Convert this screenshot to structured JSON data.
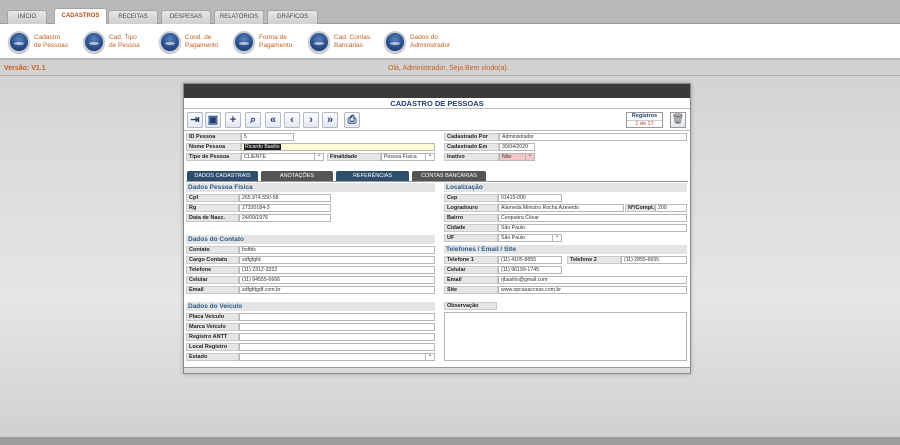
{
  "tabs": [
    "INÍCIO",
    "CADASTROS",
    "RECEITAS",
    "DESPESAS",
    "RELATÓRIOS",
    "GRÁFICOS"
  ],
  "active_tab": "CADASTROS",
  "submenu": [
    {
      "label": "Cadastro\nde Pessoas",
      "icon": "person-globe-icon"
    },
    {
      "label": "Cad. Tipo\nde Pessoa",
      "icon": "type-globe-icon"
    },
    {
      "label": "Cond. de\nPagamento",
      "icon": "payment-globe-icon"
    },
    {
      "label": "Forma de\nPagamento",
      "icon": "method-globe-icon"
    },
    {
      "label": "Cad. Contas\nBancárias",
      "icon": "bank-globe-icon"
    },
    {
      "label": "Dados do\nAdministrador",
      "icon": "admin-globe-icon"
    }
  ],
  "version": "Versão: V1.1",
  "welcome": "Olá, Administrador, Seja Bem vindo(a).",
  "form": {
    "title": "CADASTRO DE PESSOAS",
    "toolbar_icons": [
      "exit-icon",
      "save-icon",
      "add-icon",
      "search-icon",
      "first-icon",
      "previous-icon",
      "next-icon",
      "last-icon",
      "print-icon"
    ],
    "registros_label": "Registros",
    "registros_value": "1 de 17",
    "delete_icon": "trash-icon",
    "id_label": "ID Pessoa",
    "id_value": "5",
    "nome_label": "Nome Pessoa",
    "nome_value": "Ricardo Basilio",
    "tipo_label": "Tipo de Pessoa",
    "tipo_value": "CLIENTE",
    "finalidade_label": "Finalidade",
    "finalidade_value": "Pessoa Física",
    "cad_por_label": "Cadastrado Por",
    "cad_por_value": "Administrador",
    "cad_em_label": "Cadastrado Em",
    "cad_em_value": "30/04/2020",
    "inativo_label": "Inativo",
    "inativo_value": "Não",
    "subtabs": [
      "DADOS  CADASTRAIS",
      "ANOTAÇÕES",
      "REFERÊNCIAS",
      "CONTAS BANCÁRIAS"
    ],
    "sec_pf": "Dados Pessoa Física",
    "cpf_label": "Cpf",
    "cpf_value": "265.974.550-58",
    "rg_label": "Rg",
    "rg_value": "27320184-3",
    "nasc_label": "Data de Nasc.",
    "nasc_value": "24/09/1976",
    "sec_contato": "Dados do Contato",
    "contato_label": "Contato",
    "contato_value": "fsdfds",
    "cargo_label": "Cargo Contato",
    "cargo_value": "sdfgfgfd",
    "tel_label": "Telefone",
    "tel_value": "(11) 2312-3322",
    "cel_label": "Celular",
    "cel_value": "(11) 94555-6666",
    "email_label": "Email",
    "email_value": "sdfgfdgdf.com.br",
    "sec_veiculo": "Dados do Veículo",
    "placa_label": "Placa Veículo",
    "marca_label": "Marca Veículo",
    "antt_label": "Registro ANTT",
    "local_label": "Local Registro",
    "estado_label": "Estado",
    "sec_local": "Localização",
    "cep_label": "Cep",
    "cep_value": "01415-000",
    "logr_label": "Logradouro",
    "logr_value": "Alameda Ministro Rocha Azevedo",
    "num_label": "Nº/Compl.",
    "num_value": "200",
    "bairro_label": "Bairro",
    "bairro_value": "Cerqueira César",
    "cidade_label": "Cidade",
    "cidade_value": "São Paulo",
    "uf_label": "UF",
    "uf_value": "São Paulo",
    "sec_fones": "Telefones / Email / Site",
    "tel1_label": "Telefone 1",
    "tel1_value": "(11) 4105-8855",
    "tel2_label": "Telefone 2",
    "tel2_value": "(11) 2855-6655",
    "cel2_label": "Celular",
    "cel2_value": "(11) 96199-1745",
    "email2_label": "Email",
    "email2_value": "rjbasilio@gmail.com",
    "site_label": "Site",
    "site_value": "www.opcaoaccess.com.br",
    "obs_label": "Observação"
  }
}
